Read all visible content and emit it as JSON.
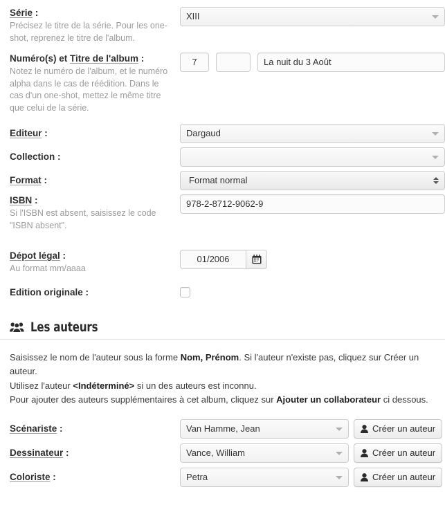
{
  "form": {
    "fields": [
      {
        "id": "serie",
        "label_plain": "",
        "label_underlined": "Série",
        "label_suffix": " :",
        "help": "Précisez le titre de la série. Pour les one-shot, reprenez le titre de l'album.",
        "control": "select",
        "value": "XIII"
      },
      {
        "id": "numero-titre",
        "label_plain": "Numéro(s) et ",
        "label_underlined": "Titre de l'album",
        "label_suffix": " :",
        "help": "Notez le numéro de l'album, et le numéro alpha dans le cas de réédition. Dans le cas d'un one-shot, mettez le même titre que celui de la série.",
        "control": "number-title",
        "number_value": "7",
        "alpha_value": "",
        "title_value": "La nuit du 3 Août"
      },
      {
        "id": "editeur",
        "label_plain": "",
        "label_underlined": "Editeur",
        "label_suffix": " :",
        "help": "",
        "control": "select",
        "value": "Dargaud"
      },
      {
        "id": "collection",
        "label_plain": "Collection",
        "label_underlined": "",
        "label_suffix": " :",
        "help": "",
        "control": "select",
        "value": ""
      },
      {
        "id": "format",
        "label_plain": "",
        "label_underlined": "Format",
        "label_suffix": " :",
        "help": "",
        "control": "native-select",
        "value": "Format normal"
      },
      {
        "id": "isbn",
        "label_plain": "",
        "label_underlined": "ISBN",
        "label_suffix": " :",
        "help": "Si l'ISBN est absent, saisissez le code \"ISBN absent\".",
        "control": "text",
        "value": "978-2-8712-9062-9"
      },
      {
        "id": "depot-legal",
        "label_plain": "",
        "label_underlined": "Dépot légal",
        "label_suffix": " :",
        "help": "Au format mm/aaaa",
        "control": "date",
        "value": "01/2006",
        "icon": "calendar-icon"
      },
      {
        "id": "edition-originale",
        "label_plain": "Edition originale",
        "label_underlined": "",
        "label_suffix": " :",
        "help": "",
        "control": "checkbox",
        "checked": false
      }
    ]
  },
  "authors_section": {
    "icon": "users-group-icon",
    "title": "Les auteurs",
    "notes": [
      {
        "parts": [
          {
            "t": "Saisissez le nom de l'auteur sous la forme ",
            "b": false
          },
          {
            "t": "Nom, Prénom",
            "b": true
          },
          {
            "t": ". Si l'auteur n'existe pas, cliquez sur Créer un auteur.",
            "b": false
          }
        ]
      },
      {
        "parts": [
          {
            "t": "Utilisez l'auteur ",
            "b": false
          },
          {
            "t": "<Indéterminé>",
            "b": true
          },
          {
            "t": " si un des auteurs est inconnu.",
            "b": false
          }
        ]
      },
      {
        "parts": [
          {
            "t": "Pour ajouter des auteurs supplémentaires à cet album, cliquez sur ",
            "b": false
          },
          {
            "t": "Ajouter un collaborateur",
            "b": true
          },
          {
            "t": " ci dessous.",
            "b": false
          }
        ]
      }
    ],
    "rows": [
      {
        "id": "scenariste",
        "label": "Scénariste",
        "label_suffix": " :",
        "value": "Van Hamme, Jean",
        "button_label": "Créer un auteur",
        "button_icon": "user-icon"
      },
      {
        "id": "dessinateur",
        "label": "Dessinateur",
        "label_suffix": " :",
        "value": "Vance, William",
        "button_label": "Créer un auteur",
        "button_icon": "user-icon"
      },
      {
        "id": "coloriste",
        "label": "Coloriste",
        "label_suffix": " :",
        "value": "Petra",
        "button_label": "Créer un auteur",
        "button_icon": "user-icon"
      }
    ]
  },
  "colors": {
    "text": "#333333",
    "label": "#2f2f2f",
    "help": "#9b9b9b",
    "border": "#cccccc",
    "field_bg": "#fbfbfb",
    "divider": "#e2e2e2"
  }
}
